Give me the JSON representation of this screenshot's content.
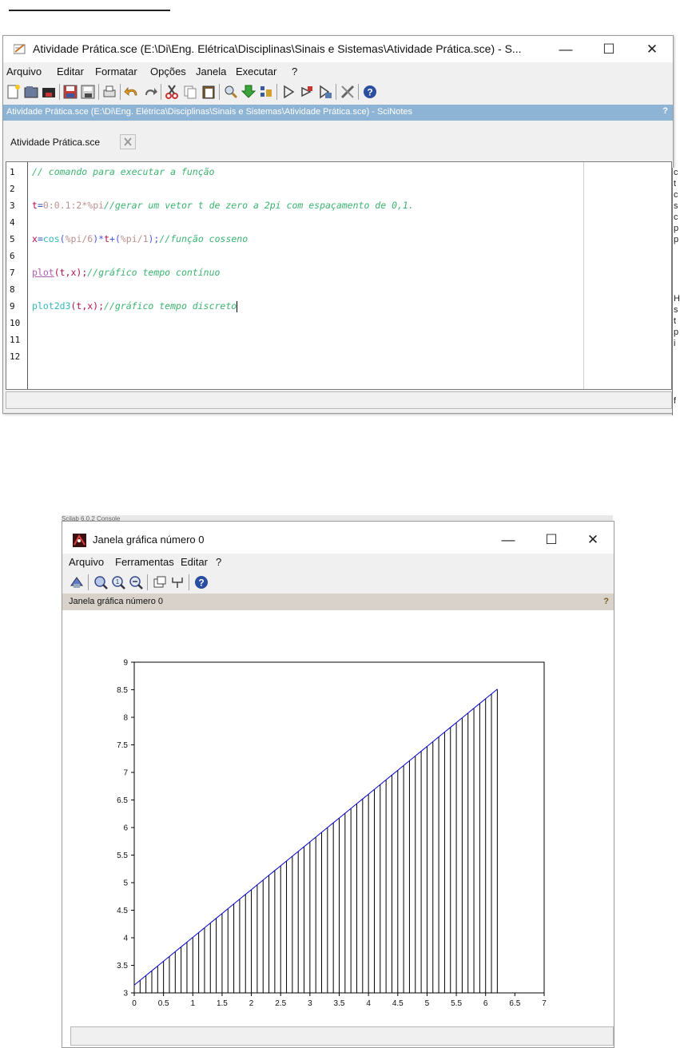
{
  "scinotes": {
    "title": "Atividade Prática.sce (E:\\Di\\Eng. Elétrica\\Disciplinas\\Sinais e Sistemas\\Atividade Prática.sce) - S...",
    "menu": [
      "Arquivo",
      "Editar",
      "Formatar",
      "Opções",
      "Janela",
      "Executar",
      "?"
    ],
    "path_bar": "Atividade Prática.sce (E:\\Di\\Eng. Elétrica\\Disciplinas\\Sinais e Sistemas\\Atividade Prática.sce) - SciNotes",
    "help": "?",
    "tab_label": "Atividade Prática.sce",
    "line_numbers": [
      "1",
      "2",
      "3",
      "4",
      "5",
      "6",
      "7",
      "8",
      "9",
      "10",
      "11",
      "12"
    ],
    "code": {
      "l1": "// comando para executar a função",
      "l3_var": "t",
      "l3_eq": "=",
      "l3_expr": "0:0.1:2*",
      "l3_pi": "%pi",
      "l3_comment": "//gerar um vetor t de zero a 2pi com espaçamento de 0,1.",
      "l5_var": "x",
      "l5_eq": "=",
      "l5_fn": "cos",
      "l5_p1": "(",
      "l5_pi1": "%pi/6",
      "l5_p2": ")*",
      "l5_t": "t",
      "l5_plus": "+(",
      "l5_pi2": "%pi/1",
      "l5_p3": ");",
      "l5_comment": "//função cosseno",
      "l7_fn": "plot",
      "l7_args": "(t,x);",
      "l7_comment": "//gráfico tempo contínuo",
      "l9_fn": "plot2d3",
      "l9_args": "(t,x);",
      "l9_comment": "//gráfico tempo discreto"
    },
    "win_controls": {
      "minimize": "—",
      "maximize": "☐",
      "close": "✕"
    }
  },
  "side_console": [
    "c",
    "t",
    "c",
    "s",
    "c",
    "p",
    "p",
    "H",
    "s",
    "t",
    "p",
    "i",
    "f"
  ],
  "graphics": {
    "console_label": "Scilab 6.0.2 Console",
    "title": "Janela gráfica número 0",
    "menu": [
      "Arquivo",
      "Ferramentas",
      "Editar",
      "?"
    ],
    "bar_label": "Janela gráfica número 0",
    "help": "?",
    "win_controls": {
      "minimize": "—",
      "maximize": "☐",
      "close": "✕"
    }
  },
  "chart_data": {
    "type": "stem",
    "title": "",
    "xlabel": "",
    "ylabel": "",
    "xlim": [
      0,
      7
    ],
    "ylim": [
      3,
      9
    ],
    "xticks": [
      "0",
      "0.5",
      "1",
      "1.5",
      "2",
      "2.5",
      "3",
      "3.5",
      "4",
      "4.5",
      "5",
      "5.5",
      "6",
      "6.5",
      "7"
    ],
    "yticks": [
      "3",
      "3.5",
      "4",
      "4.5",
      "5",
      "5.5",
      "6",
      "6.5",
      "7",
      "7.5",
      "8",
      "8.5",
      "9"
    ],
    "x_start": 0,
    "x_step": 0.1,
    "x_end": 6.2,
    "slope": 0.866,
    "intercept": 3.1416,
    "series_color": "#0000cc",
    "stem_color": "#000000"
  },
  "colors": {
    "path_bar": "#8eb4d5",
    "graphics_bar": "#d9d2cb"
  }
}
